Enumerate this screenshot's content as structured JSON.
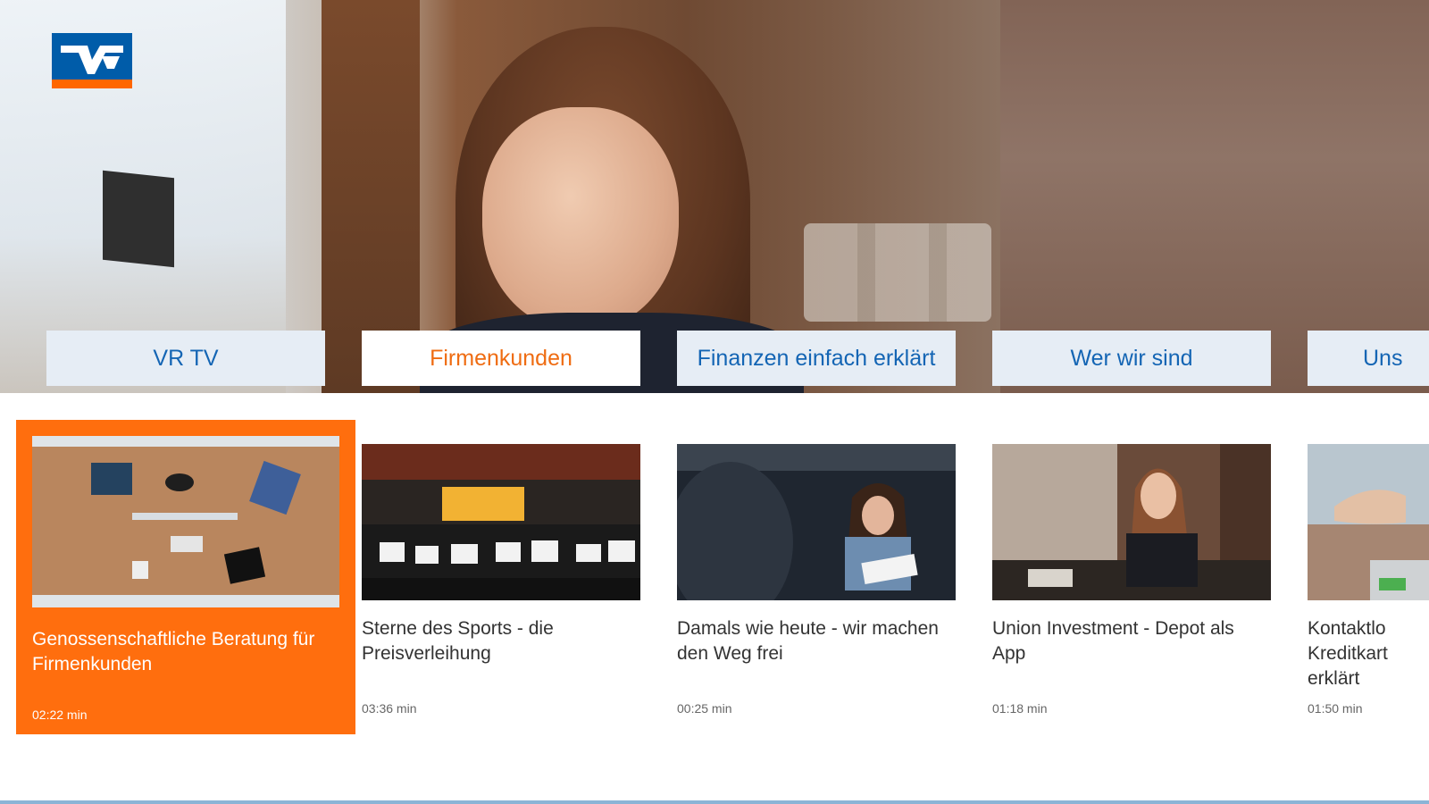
{
  "app": {
    "name": "VR TV"
  },
  "logo": {
    "name": "Volksbanken Raiffeisenbanken",
    "colors": {
      "blue": "#005ca9",
      "orange": "#ff6600"
    }
  },
  "tabs": [
    {
      "label": "VR TV",
      "active": false
    },
    {
      "label": "Firmenkunden",
      "active": true
    },
    {
      "label": "Finanzen einfach erklärt",
      "active": false
    },
    {
      "label": "Wer wir sind",
      "active": false
    },
    {
      "label": "Uns",
      "active": false
    }
  ],
  "featured": {
    "title": "Genossenschaftliche Beratung für Firmenkunden",
    "duration": "02:22 min",
    "thumb": "desk-overhead-image"
  },
  "videos": [
    {
      "title": "Sterne des Sports - die Preisverleihung",
      "duration": "03:36 min",
      "thumb": "award-ceremony-image"
    },
    {
      "title": "Damals wie heute - wir machen den Weg frei",
      "duration": "00:25 min",
      "thumb": "woman-reading-image"
    },
    {
      "title": "Union Investment - Depot als App",
      "duration": "01:18 min",
      "thumb": "woman-cafe-image"
    },
    {
      "title": "Kontaktlo Kreditkart erklärt",
      "duration": "01:50 min",
      "thumb": "card-payment-image"
    }
  ],
  "colors": {
    "accent": "#ff6e0e",
    "tab_text": "#1465b4",
    "tab_bg": "#e6edf5",
    "active_tab_text": "#ef6c12"
  }
}
